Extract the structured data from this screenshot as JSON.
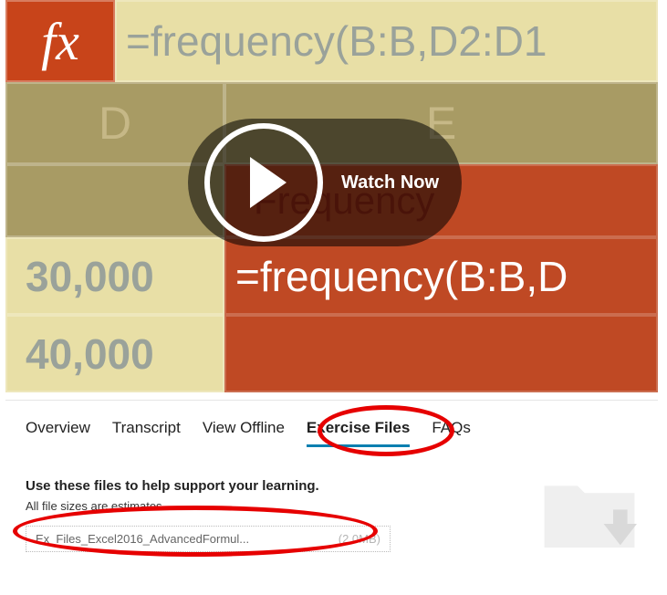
{
  "video": {
    "fx": "fx",
    "formula_bar": "=frequency(B:B,D2:D1",
    "col_d": "D",
    "col_e": "E",
    "freq_word": "Frequency",
    "num1": "30,000",
    "num2": "40,000",
    "red_formula": "=frequency(B:B,D",
    "watch_label": "Watch Now"
  },
  "tabs": {
    "overview": "Overview",
    "transcript": "Transcript",
    "view_offline": "View Offline",
    "exercise_files": "Exercise Files",
    "faqs": "FAQs"
  },
  "content": {
    "heading": "Use these files to help support your learning.",
    "estimate_note": "All file sizes are estimates.",
    "file_name": "Ex_Files_Excel2016_AdvancedFormul...",
    "file_size": "(2.0MB)"
  }
}
